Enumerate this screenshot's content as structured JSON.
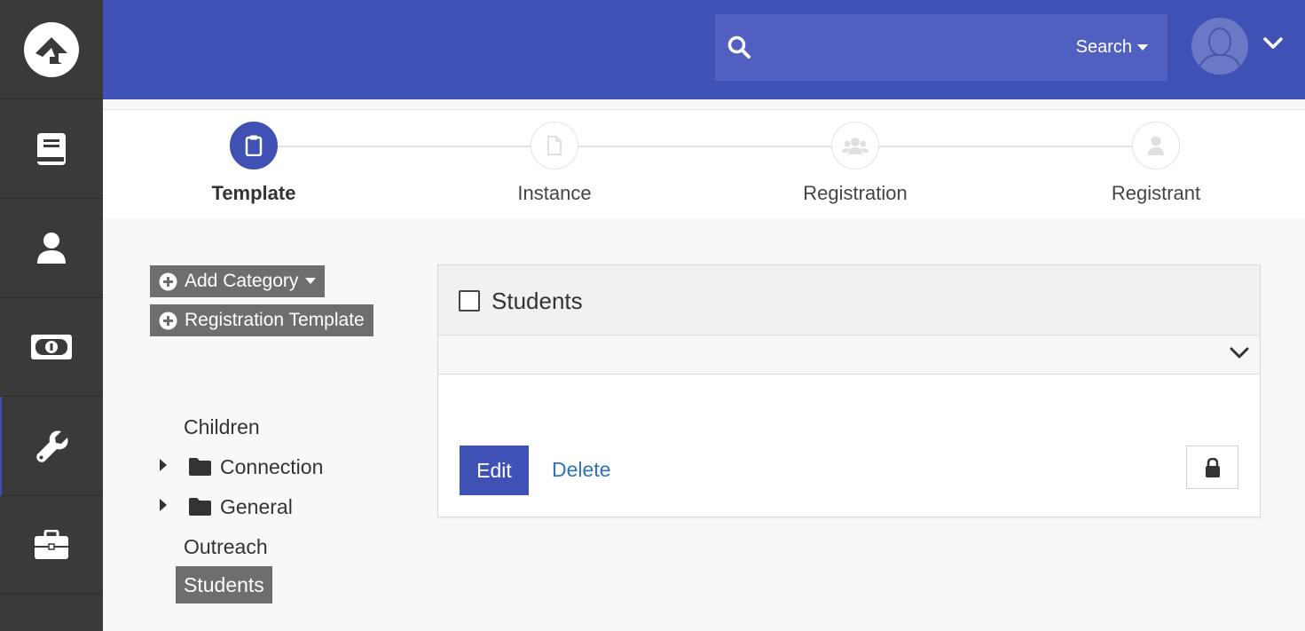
{
  "header": {
    "search": {
      "placeholder": "",
      "scope_label": "Search"
    }
  },
  "sidebar": {
    "items": [
      {
        "icon": "rock-logo-icon"
      },
      {
        "icon": "book-icon"
      },
      {
        "icon": "person-icon"
      },
      {
        "icon": "money-icon"
      },
      {
        "icon": "wrench-icon",
        "active": true
      },
      {
        "icon": "briefcase-icon"
      }
    ]
  },
  "wizard": {
    "steps": [
      {
        "label": "Template",
        "icon": "clipboard-icon",
        "active": true
      },
      {
        "label": "Instance",
        "icon": "file-icon",
        "active": false
      },
      {
        "label": "Registration",
        "icon": "users-icon",
        "active": false
      },
      {
        "label": "Registrant",
        "icon": "user-icon",
        "active": false
      }
    ]
  },
  "actions": {
    "add_category": "Add Category",
    "add_template": "Registration Template"
  },
  "tree": {
    "items": [
      {
        "label": "Children",
        "folder": false
      },
      {
        "label": "Connection",
        "folder": true
      },
      {
        "label": "General",
        "folder": true
      },
      {
        "label": "Outreach",
        "folder": false
      },
      {
        "label": "Students",
        "folder": false,
        "selected": true
      }
    ]
  },
  "detail": {
    "title": "Students",
    "edit_label": "Edit",
    "delete_label": "Delete"
  },
  "colors": {
    "brand": "#3f51b5",
    "sidebar": "#3a3a3a",
    "link": "#2c73c0"
  }
}
